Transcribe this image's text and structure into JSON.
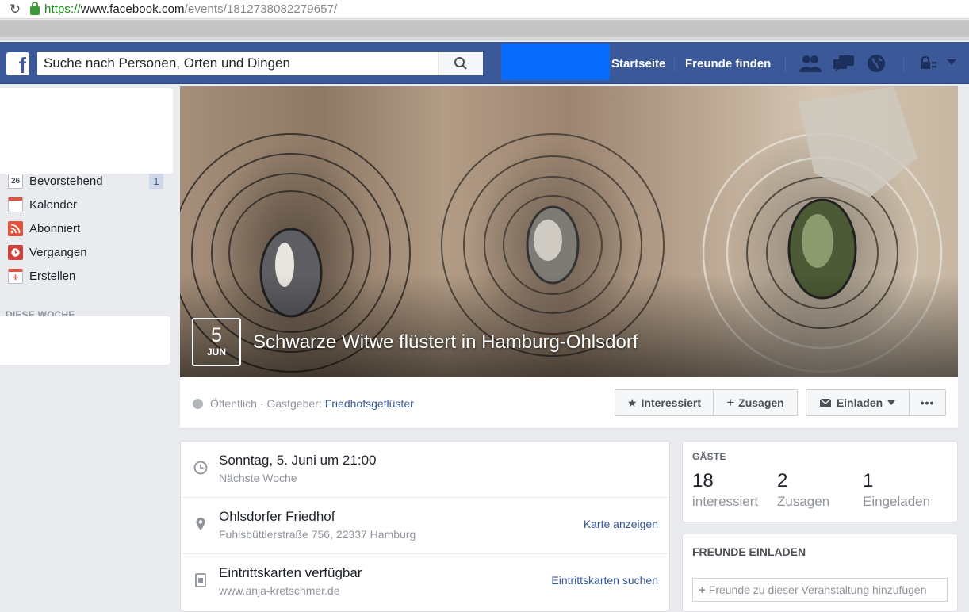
{
  "browser": {
    "url_protocol": "https://",
    "url_host": "www.facebook.com",
    "url_path": "/events/1812738082279657/"
  },
  "topbar": {
    "search_placeholder": "Suche nach Personen, Orten und Dingen",
    "nav": [
      "Startseite",
      "Freunde finden"
    ],
    "brand_color": "#3b5998"
  },
  "sidebar": {
    "items": [
      {
        "label": "Bevorstehend",
        "icon": "calendar-26-icon",
        "icon_text": "26",
        "badge": "1"
      },
      {
        "label": "Kalender",
        "icon": "calendar-grid-icon"
      },
      {
        "label": "Abonniert",
        "icon": "rss-icon"
      },
      {
        "label": "Vergangen",
        "icon": "clock-icon"
      },
      {
        "label": "Erstellen",
        "icon": "create-event-icon"
      }
    ],
    "section_header": "DIESE WOCHE"
  },
  "event": {
    "day": "5",
    "month": "JUN",
    "title": "Schwarze Witwe flüstert in Hamburg-Ohlsdorf",
    "privacy": "Öffentlich",
    "host_label": "· Gastgeber:",
    "host_name": "Friedhofsgeflüster"
  },
  "actions": {
    "interested": "Interessiert",
    "going": "Zusagen",
    "invite": "Einladen",
    "more": "•••"
  },
  "details": {
    "datetime": {
      "title": "Sonntag, 5. Juni um 21:00",
      "sub": "Nächste Woche"
    },
    "location": {
      "title": "Ohlsdorfer Friedhof",
      "sub": "Fuhlsbüttlerstraße 756, 22337 Hamburg",
      "link": "Karte anzeigen"
    },
    "tickets": {
      "title": "Eintrittskarten verfügbar",
      "sub": "www.anja-kretschmer.de",
      "link": "Eintrittskarten suchen"
    }
  },
  "guests": {
    "header": "GÄSTE",
    "stats": [
      {
        "count": "18",
        "label": "interessiert"
      },
      {
        "count": "2",
        "label": "Zusagen"
      },
      {
        "count": "1",
        "label": "Eingeladen"
      }
    ]
  },
  "invite_friends": {
    "header": "FREUNDE EINLADEN",
    "placeholder": "Freunde zu dieser Veranstaltung hinzufügen"
  }
}
